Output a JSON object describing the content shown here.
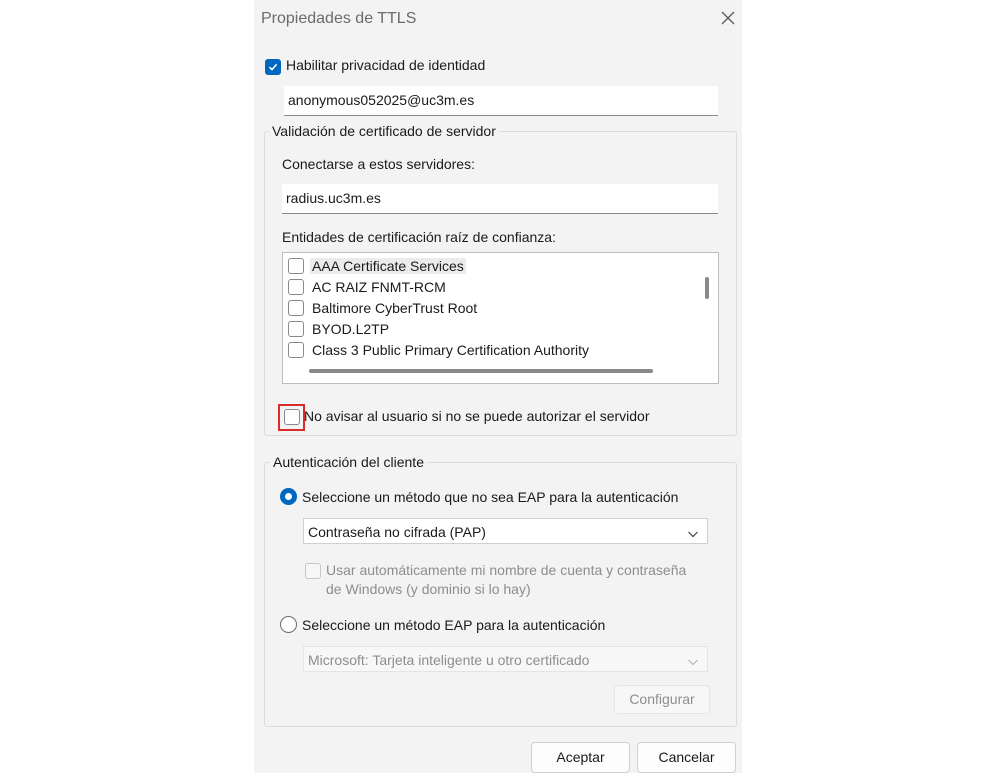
{
  "window": {
    "title": "Propiedades de TTLS"
  },
  "identity": {
    "enable_label": "Habilitar privacidad de identidad",
    "enabled": true,
    "value": "anonymous052025@uc3m.es"
  },
  "server_validation": {
    "group_title": "Validación de certificado de servidor",
    "connect_label": "Conectarse a estos servidores:",
    "servers_value": "radius.uc3m.es",
    "root_ca_label": "Entidades de certificación raíz de confianza:",
    "root_cas": [
      {
        "name": "AAA Certificate Services",
        "checked": false
      },
      {
        "name": "AC RAIZ FNMT-RCM",
        "checked": false
      },
      {
        "name": "Baltimore CyberTrust Root",
        "checked": false
      },
      {
        "name": "BYOD.L2TP",
        "checked": false
      },
      {
        "name": "Class 3 Public Primary Certification Authority",
        "checked": false
      }
    ],
    "no_prompt_label": "No avisar al usuario si no se puede autorizar el servidor",
    "no_prompt_checked": false
  },
  "client_auth": {
    "group_title": "Autenticación del cliente",
    "non_eap_label": "Seleccione un método que no sea EAP para la autenticación",
    "non_eap_selected": true,
    "non_eap_method": "Contraseña no cifrada (PAP)",
    "auto_creds_line1": "Usar automáticamente mi nombre de cuenta y contraseña",
    "auto_creds_line2": "de Windows (y dominio si lo hay)",
    "eap_label": "Seleccione un método EAP para la autenticación",
    "eap_selected": false,
    "eap_method": "Microsoft: Tarjeta inteligente u otro certificado",
    "configure_label": "Configurar"
  },
  "footer": {
    "ok_label": "Aceptar",
    "cancel_label": "Cancelar"
  },
  "colors": {
    "accent": "#0067c0",
    "highlight": "#d92b2b",
    "dialog_bg": "#f3f3f3"
  }
}
